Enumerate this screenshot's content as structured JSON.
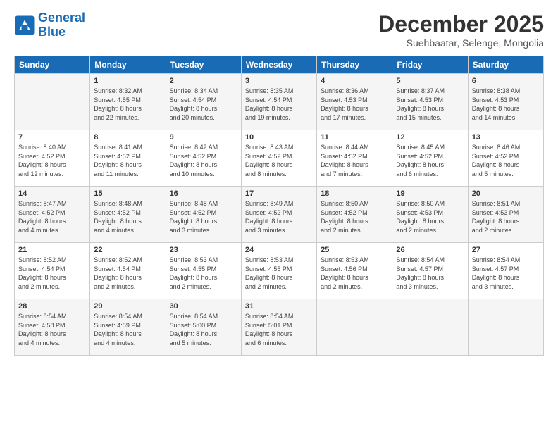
{
  "header": {
    "logo_line1": "General",
    "logo_line2": "Blue",
    "month": "December 2025",
    "location": "Suehbaatar, Selenge, Mongolia"
  },
  "days_of_week": [
    "Sunday",
    "Monday",
    "Tuesday",
    "Wednesday",
    "Thursday",
    "Friday",
    "Saturday"
  ],
  "weeks": [
    [
      {
        "day": "",
        "info": ""
      },
      {
        "day": "1",
        "info": "Sunrise: 8:32 AM\nSunset: 4:55 PM\nDaylight: 8 hours\nand 22 minutes."
      },
      {
        "day": "2",
        "info": "Sunrise: 8:34 AM\nSunset: 4:54 PM\nDaylight: 8 hours\nand 20 minutes."
      },
      {
        "day": "3",
        "info": "Sunrise: 8:35 AM\nSunset: 4:54 PM\nDaylight: 8 hours\nand 19 minutes."
      },
      {
        "day": "4",
        "info": "Sunrise: 8:36 AM\nSunset: 4:53 PM\nDaylight: 8 hours\nand 17 minutes."
      },
      {
        "day": "5",
        "info": "Sunrise: 8:37 AM\nSunset: 4:53 PM\nDaylight: 8 hours\nand 15 minutes."
      },
      {
        "day": "6",
        "info": "Sunrise: 8:38 AM\nSunset: 4:53 PM\nDaylight: 8 hours\nand 14 minutes."
      }
    ],
    [
      {
        "day": "7",
        "info": "Sunrise: 8:40 AM\nSunset: 4:52 PM\nDaylight: 8 hours\nand 12 minutes."
      },
      {
        "day": "8",
        "info": "Sunrise: 8:41 AM\nSunset: 4:52 PM\nDaylight: 8 hours\nand 11 minutes."
      },
      {
        "day": "9",
        "info": "Sunrise: 8:42 AM\nSunset: 4:52 PM\nDaylight: 8 hours\nand 10 minutes."
      },
      {
        "day": "10",
        "info": "Sunrise: 8:43 AM\nSunset: 4:52 PM\nDaylight: 8 hours\nand 8 minutes."
      },
      {
        "day": "11",
        "info": "Sunrise: 8:44 AM\nSunset: 4:52 PM\nDaylight: 8 hours\nand 7 minutes."
      },
      {
        "day": "12",
        "info": "Sunrise: 8:45 AM\nSunset: 4:52 PM\nDaylight: 8 hours\nand 6 minutes."
      },
      {
        "day": "13",
        "info": "Sunrise: 8:46 AM\nSunset: 4:52 PM\nDaylight: 8 hours\nand 5 minutes."
      }
    ],
    [
      {
        "day": "14",
        "info": "Sunrise: 8:47 AM\nSunset: 4:52 PM\nDaylight: 8 hours\nand 4 minutes."
      },
      {
        "day": "15",
        "info": "Sunrise: 8:48 AM\nSunset: 4:52 PM\nDaylight: 8 hours\nand 4 minutes."
      },
      {
        "day": "16",
        "info": "Sunrise: 8:48 AM\nSunset: 4:52 PM\nDaylight: 8 hours\nand 3 minutes."
      },
      {
        "day": "17",
        "info": "Sunrise: 8:49 AM\nSunset: 4:52 PM\nDaylight: 8 hours\nand 3 minutes."
      },
      {
        "day": "18",
        "info": "Sunrise: 8:50 AM\nSunset: 4:52 PM\nDaylight: 8 hours\nand 2 minutes."
      },
      {
        "day": "19",
        "info": "Sunrise: 8:50 AM\nSunset: 4:53 PM\nDaylight: 8 hours\nand 2 minutes."
      },
      {
        "day": "20",
        "info": "Sunrise: 8:51 AM\nSunset: 4:53 PM\nDaylight: 8 hours\nand 2 minutes."
      }
    ],
    [
      {
        "day": "21",
        "info": "Sunrise: 8:52 AM\nSunset: 4:54 PM\nDaylight: 8 hours\nand 2 minutes."
      },
      {
        "day": "22",
        "info": "Sunrise: 8:52 AM\nSunset: 4:54 PM\nDaylight: 8 hours\nand 2 minutes."
      },
      {
        "day": "23",
        "info": "Sunrise: 8:53 AM\nSunset: 4:55 PM\nDaylight: 8 hours\nand 2 minutes."
      },
      {
        "day": "24",
        "info": "Sunrise: 8:53 AM\nSunset: 4:55 PM\nDaylight: 8 hours\nand 2 minutes."
      },
      {
        "day": "25",
        "info": "Sunrise: 8:53 AM\nSunset: 4:56 PM\nDaylight: 8 hours\nand 2 minutes."
      },
      {
        "day": "26",
        "info": "Sunrise: 8:54 AM\nSunset: 4:57 PM\nDaylight: 8 hours\nand 3 minutes."
      },
      {
        "day": "27",
        "info": "Sunrise: 8:54 AM\nSunset: 4:57 PM\nDaylight: 8 hours\nand 3 minutes."
      }
    ],
    [
      {
        "day": "28",
        "info": "Sunrise: 8:54 AM\nSunset: 4:58 PM\nDaylight: 8 hours\nand 4 minutes."
      },
      {
        "day": "29",
        "info": "Sunrise: 8:54 AM\nSunset: 4:59 PM\nDaylight: 8 hours\nand 4 minutes."
      },
      {
        "day": "30",
        "info": "Sunrise: 8:54 AM\nSunset: 5:00 PM\nDaylight: 8 hours\nand 5 minutes."
      },
      {
        "day": "31",
        "info": "Sunrise: 8:54 AM\nSunset: 5:01 PM\nDaylight: 8 hours\nand 6 minutes."
      },
      {
        "day": "",
        "info": ""
      },
      {
        "day": "",
        "info": ""
      },
      {
        "day": "",
        "info": ""
      }
    ]
  ]
}
